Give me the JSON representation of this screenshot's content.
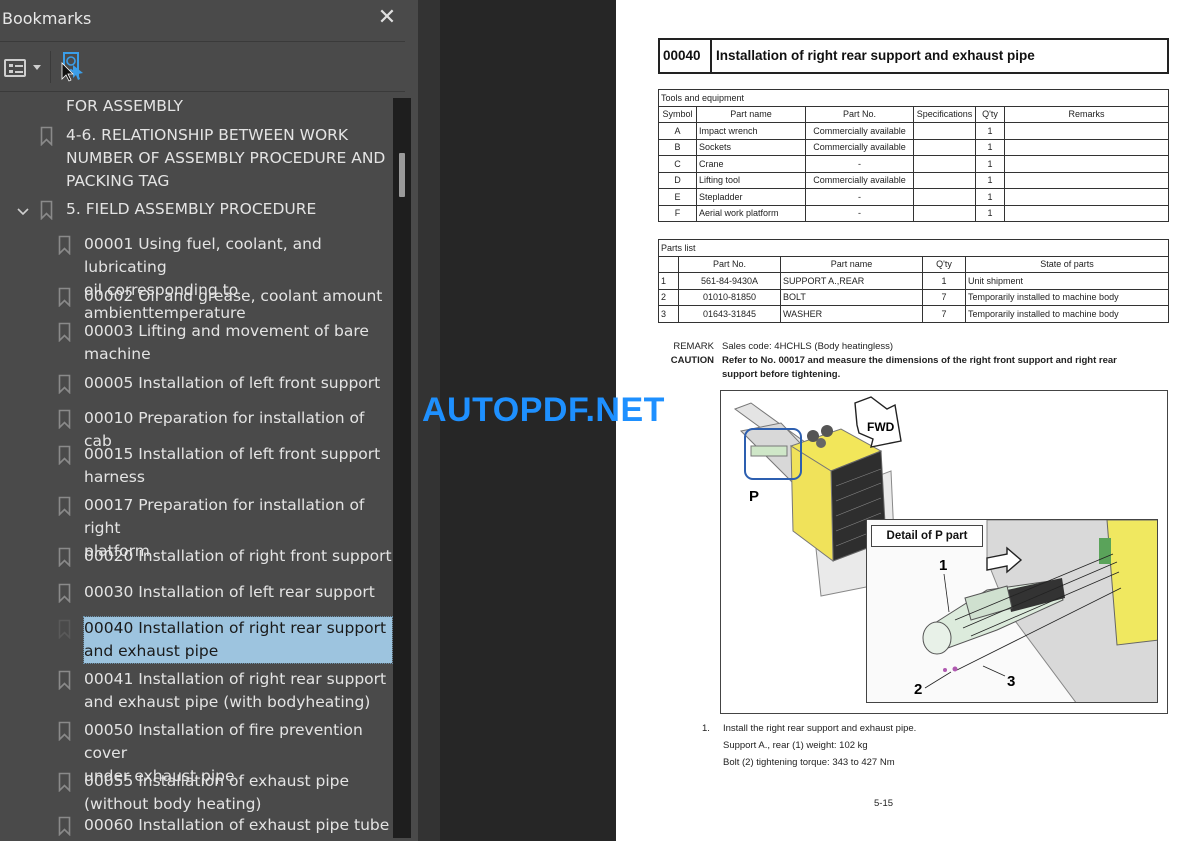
{
  "sidebar": {
    "title": "Bookmarks",
    "close_icon": "close-icon",
    "toolbar": {
      "options_icon": "list-options-icon",
      "find_icon": "find-current-bookmark-icon"
    },
    "items": [
      {
        "label": "FOR ASSEMBLY",
        "lines": [
          "FOR ASSEMBLY"
        ],
        "level": 1,
        "continued": true
      },
      {
        "label": "4-6. RELATIONSHIP BETWEEN WORK NUMBER OF ASSEMBLY PROCEDURE AND PACKING TAG",
        "lines": [
          "4-6. RELATIONSHIP BETWEEN WORK",
          "NUMBER OF ASSEMBLY PROCEDURE AND",
          "PACKING TAG"
        ],
        "level": 1
      },
      {
        "label": "5. FIELD ASSEMBLY PROCEDURE",
        "lines": [
          "5. FIELD ASSEMBLY PROCEDURE"
        ],
        "level": 1,
        "expanded": true
      },
      {
        "label": "00001 Using fuel, coolant, and lubricating oil corresponding to ambienttemperature",
        "lines": [
          "00001 Using fuel, coolant, and lubricating",
          "oil corresponding to ambienttemperature"
        ],
        "level": 2
      },
      {
        "label": "00002 Oil and grease, coolant amount",
        "lines": [
          "00002 Oil and grease, coolant amount"
        ],
        "level": 2
      },
      {
        "label": "00003 Lifting and movement of bare machine",
        "lines": [
          "00003 Lifting and movement of bare",
          "machine"
        ],
        "level": 2
      },
      {
        "label": "00005 Installation of left front support",
        "lines": [
          "00005 Installation of left front support"
        ],
        "level": 2
      },
      {
        "label": "00010 Preparation for installation of cab",
        "lines": [
          "00010 Preparation for installation of cab"
        ],
        "level": 2
      },
      {
        "label": "00015 Installation of left front support harness",
        "lines": [
          "00015 Installation of left front support",
          "harness"
        ],
        "level": 2
      },
      {
        "label": "00017 Preparation for installation of right platform",
        "lines": [
          "00017 Preparation for installation of right",
          "platform"
        ],
        "level": 2
      },
      {
        "label": "00020 Installation of right front support",
        "lines": [
          "00020 Installation of right front support"
        ],
        "level": 2
      },
      {
        "label": "00030 Installation of left rear support",
        "lines": [
          "00030 Installation of left rear support"
        ],
        "level": 2
      },
      {
        "label": "00040 Installation of right rear support and exhaust pipe",
        "lines": [
          "00040 Installation of right rear support",
          "and exhaust pipe"
        ],
        "level": 2,
        "selected": true
      },
      {
        "label": "00041 Installation of right rear support and exhaust pipe (with bodyheating)",
        "lines": [
          "00041 Installation of right rear support",
          "and exhaust pipe (with bodyheating)"
        ],
        "level": 2
      },
      {
        "label": "00050 Installation of fire prevention cover under exhaust pipe",
        "lines": [
          "00050 Installation of fire prevention cover",
          "under exhaust pipe"
        ],
        "level": 2
      },
      {
        "label": "00055 Installation of exhaust pipe (without body heating)",
        "lines": [
          "00055 Installation of exhaust pipe",
          "(without body heating)"
        ],
        "level": 2
      },
      {
        "label": "00060 Installation of exhaust pipe tube",
        "lines": [
          "00060 Installation of exhaust pipe tube"
        ],
        "level": 2,
        "clipped": true
      }
    ]
  },
  "watermark": "AUTOPDF.NET",
  "document": {
    "section_number": "00040",
    "section_title": "Installation of right rear support and exhaust pipe",
    "tools_table": {
      "caption": "Tools and equipment",
      "headers": [
        "Symbol",
        "Part name",
        "Part No.",
        "Specifications",
        "Q'ty",
        "Remarks"
      ],
      "rows": [
        [
          "A",
          "Impact wrench",
          "Commercially available",
          "",
          "1",
          ""
        ],
        [
          "B",
          "Sockets",
          "Commercially available",
          "",
          "1",
          ""
        ],
        [
          "C",
          "Crane",
          "-",
          "",
          "1",
          ""
        ],
        [
          "D",
          "Lifting tool",
          "Commercially available",
          "",
          "1",
          ""
        ],
        [
          "E",
          "Stepladder",
          "-",
          "",
          "1",
          ""
        ],
        [
          "F",
          "Aerial work platform",
          "-",
          "",
          "1",
          ""
        ]
      ]
    },
    "parts_table": {
      "caption": "Parts list",
      "headers": [
        "",
        "Part No.",
        "Part name",
        "Q'ty",
        "State of parts"
      ],
      "rows": [
        [
          "1",
          "561-84-9430A",
          "SUPPORT A.,REAR",
          "1",
          "Unit shipment"
        ],
        [
          "2",
          "01010-81850",
          "BOLT",
          "7",
          "Temporarily installed to machine body"
        ],
        [
          "3",
          "01643-31845",
          "WASHER",
          "7",
          "Temporarily installed to machine body"
        ]
      ]
    },
    "remark_label": "REMARK",
    "remark_text": "Sales code: 4HCHLS (Body heatingless)",
    "caution_label": "CAUTION",
    "caution_lines": [
      "Refer to No. 00017 and measure the dimensions of the right front support and right rear",
      "support before tightening."
    ],
    "figure": {
      "fwd_label": "FWD",
      "p_label": "P",
      "detail_label": "Detail of P part",
      "callouts": [
        "1",
        "2",
        "3"
      ]
    },
    "step_number": "1.",
    "step_lines": [
      "Install the right rear support and exhaust pipe.",
      "Support A., rear (1) weight: 102 kg",
      "Bolt (2) tightening torque: 343 to 427 Nm"
    ],
    "page_number": "5-15"
  }
}
